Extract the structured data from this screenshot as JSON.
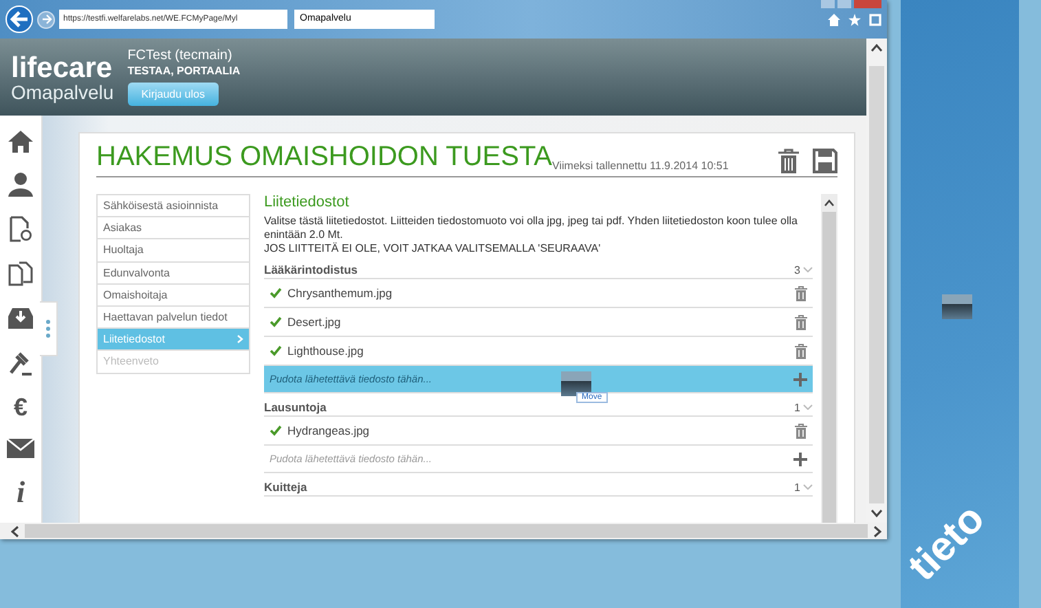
{
  "browser": {
    "url": "https://testfi.welfarelabs.net/WE.FCMyPage/Myl",
    "tab_title": "Omapalvelu"
  },
  "header": {
    "logo_main": "lifecare",
    "logo_sub": "Omapalvelu",
    "user_name": "FCTest (tecmain)",
    "organization": "TESTAA, PORTAALIA",
    "logout_button": "Kirjaudu ulos"
  },
  "icon_rail": {
    "euro_glyph": "€",
    "info_glyph": "i"
  },
  "page": {
    "title": "HAKEMUS OMAISHOIDON TUESTA",
    "last_saved": "Viimeksi tallennettu 11.9.2014 10:51"
  },
  "steps": [
    {
      "label": "Sähköisestä asioinnista",
      "selected": false,
      "disabled": false
    },
    {
      "label": "Asiakas",
      "selected": false,
      "disabled": false
    },
    {
      "label": "Huoltaja",
      "selected": false,
      "disabled": false
    },
    {
      "label": "Edunvalvonta",
      "selected": false,
      "disabled": false
    },
    {
      "label": "Omaishoitaja",
      "selected": false,
      "disabled": false
    },
    {
      "label": "Haettavan palvelun tiedot",
      "selected": false,
      "disabled": false
    },
    {
      "label": "Liitetiedostot",
      "selected": true,
      "disabled": false
    },
    {
      "label": "Yhteenveto",
      "selected": false,
      "disabled": true
    }
  ],
  "section": {
    "title": "Liitetiedostot",
    "instructions": "Valitse tästä liitetiedostot. Liitteiden tiedostomuoto voi olla jpg, jpeg tai pdf. Yhden liitetiedoston koon tulee olla enintään 2.0 Mt.",
    "notice": "JOS LIITTEITÄ EI OLE, VOIT JATKAA VALITSEMALLA 'SEURAAVA'"
  },
  "attachment_groups": [
    {
      "title": "Lääkärintodistus",
      "count": "3",
      "files": [
        "Chrysanthemum.jpg",
        "Desert.jpg",
        "Lighthouse.jpg"
      ],
      "dropzone": {
        "placeholder": "Pudota lähetettävä tiedosto tähän...",
        "highlighted": true
      }
    },
    {
      "title": "Lausuntoja",
      "count": "1",
      "files": [
        "Hydrangeas.jpg"
      ],
      "dropzone": {
        "placeholder": "Pudota lähetettävä tiedosto tähän...",
        "highlighted": false
      }
    },
    {
      "title": "Kuitteja",
      "count": "1"
    }
  ],
  "drag_ghost": {
    "action": "Move"
  },
  "wallpaper": {
    "logo": "tieto"
  }
}
